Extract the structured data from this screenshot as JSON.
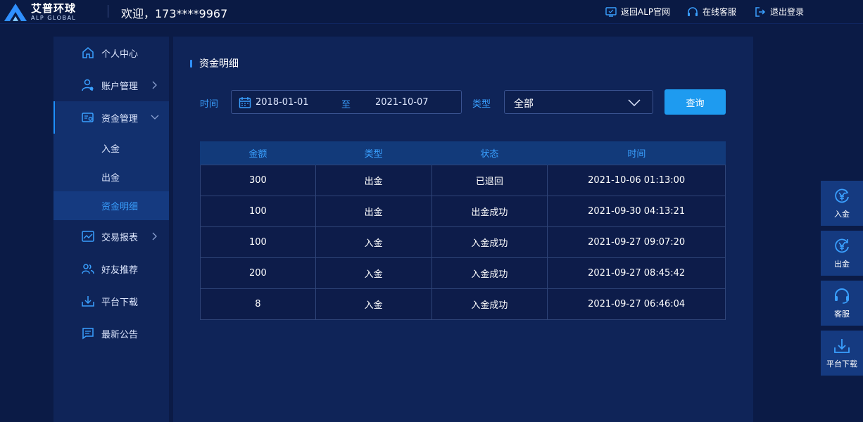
{
  "header": {
    "logo_cn": "艾普环球",
    "logo_en": "ALP GLOBAL",
    "welcome": "欢迎，173****9967",
    "links": {
      "home": "返回ALP官网",
      "service": "在线客服",
      "logout": "退出登录"
    }
  },
  "sidebar": {
    "items": [
      {
        "label": "个人中心"
      },
      {
        "label": "账户管理"
      },
      {
        "label": "资金管理"
      },
      {
        "label": "交易报表"
      },
      {
        "label": "好友推荐"
      },
      {
        "label": "平台下载"
      },
      {
        "label": "最新公告"
      }
    ],
    "sub_items": [
      {
        "label": "入金"
      },
      {
        "label": "出金"
      },
      {
        "label": "资金明细"
      }
    ]
  },
  "main": {
    "title": "资金明细",
    "filter": {
      "time_label": "时间",
      "start_date": "2018-01-01",
      "separator": "至",
      "end_date": "2021-10-07",
      "type_label": "类型",
      "type_value": "全部",
      "query_label": "查询"
    },
    "table": {
      "headers": [
        "金额",
        "类型",
        "状态",
        "时间"
      ],
      "rows": [
        [
          "300",
          "出金",
          "已退回",
          "2021-10-06 01:13:00"
        ],
        [
          "100",
          "出金",
          "出金成功",
          "2021-09-30 04:13:21"
        ],
        [
          "100",
          "入金",
          "入金成功",
          "2021-09-27 09:07:20"
        ],
        [
          "200",
          "入金",
          "入金成功",
          "2021-09-27 08:45:42"
        ],
        [
          "8",
          "入金",
          "入金成功",
          "2021-09-27 06:46:04"
        ]
      ]
    }
  },
  "float_bar": [
    {
      "label": "入金",
      "icon": "deposit-icon"
    },
    {
      "label": "出金",
      "icon": "withdraw-icon"
    },
    {
      "label": "客服",
      "icon": "headset-icon"
    },
    {
      "label": "平台下载",
      "icon": "download-icon"
    }
  ],
  "colors": {
    "accent": "#1e9bf0",
    "highlight_text": "#3aa0ff",
    "background": "#0b1b46"
  }
}
